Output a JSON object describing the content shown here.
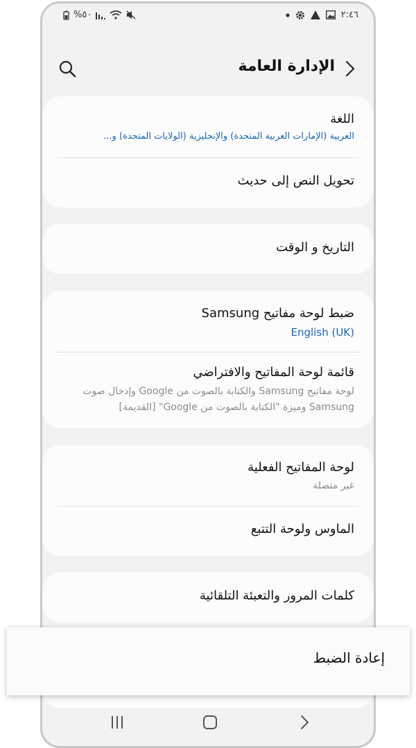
{
  "status_bar": {
    "battery": "%٥٠",
    "time": "٢:٤٦"
  },
  "header": {
    "title": "الإدارة العامة"
  },
  "items": {
    "language": {
      "title": "اللغة",
      "subtitle": "العربية (الإمارات العربية المتحدة) والإنجليزية (الولايات المتحدة) و..."
    },
    "tts": {
      "title": "تحويل النص إلى حديث"
    },
    "datetime": {
      "title": "التاريخ و الوقت"
    },
    "samsung_keyboard": {
      "title": "ضبط لوحة مفاتيح Samsung",
      "subtitle": "English (UK)"
    },
    "keyboard_list": {
      "title": "قائمة لوحة المفاتيح والافتراضي",
      "subtitle_line1": "لوحة مفاتيح Samsung والكتابة بالصوت من Google وإدخال صوت",
      "subtitle_line2": "Samsung وميزة \"الكتابة بالصوت من Google\" [القديمة]"
    },
    "physical_keyboard": {
      "title": "لوحة المفاتيح الفعلية",
      "subtitle": "غير متصلة"
    },
    "mouse": {
      "title": "الماوس ولوحة التتبع"
    },
    "passwords": {
      "title": "كلمات المرور والتعبئة التلقائية"
    }
  },
  "popup": {
    "title": "إعادة الضبط"
  },
  "colors": {
    "accent": "#1866b8",
    "background": "#f2f2f2",
    "card": "#fcfcfc"
  }
}
